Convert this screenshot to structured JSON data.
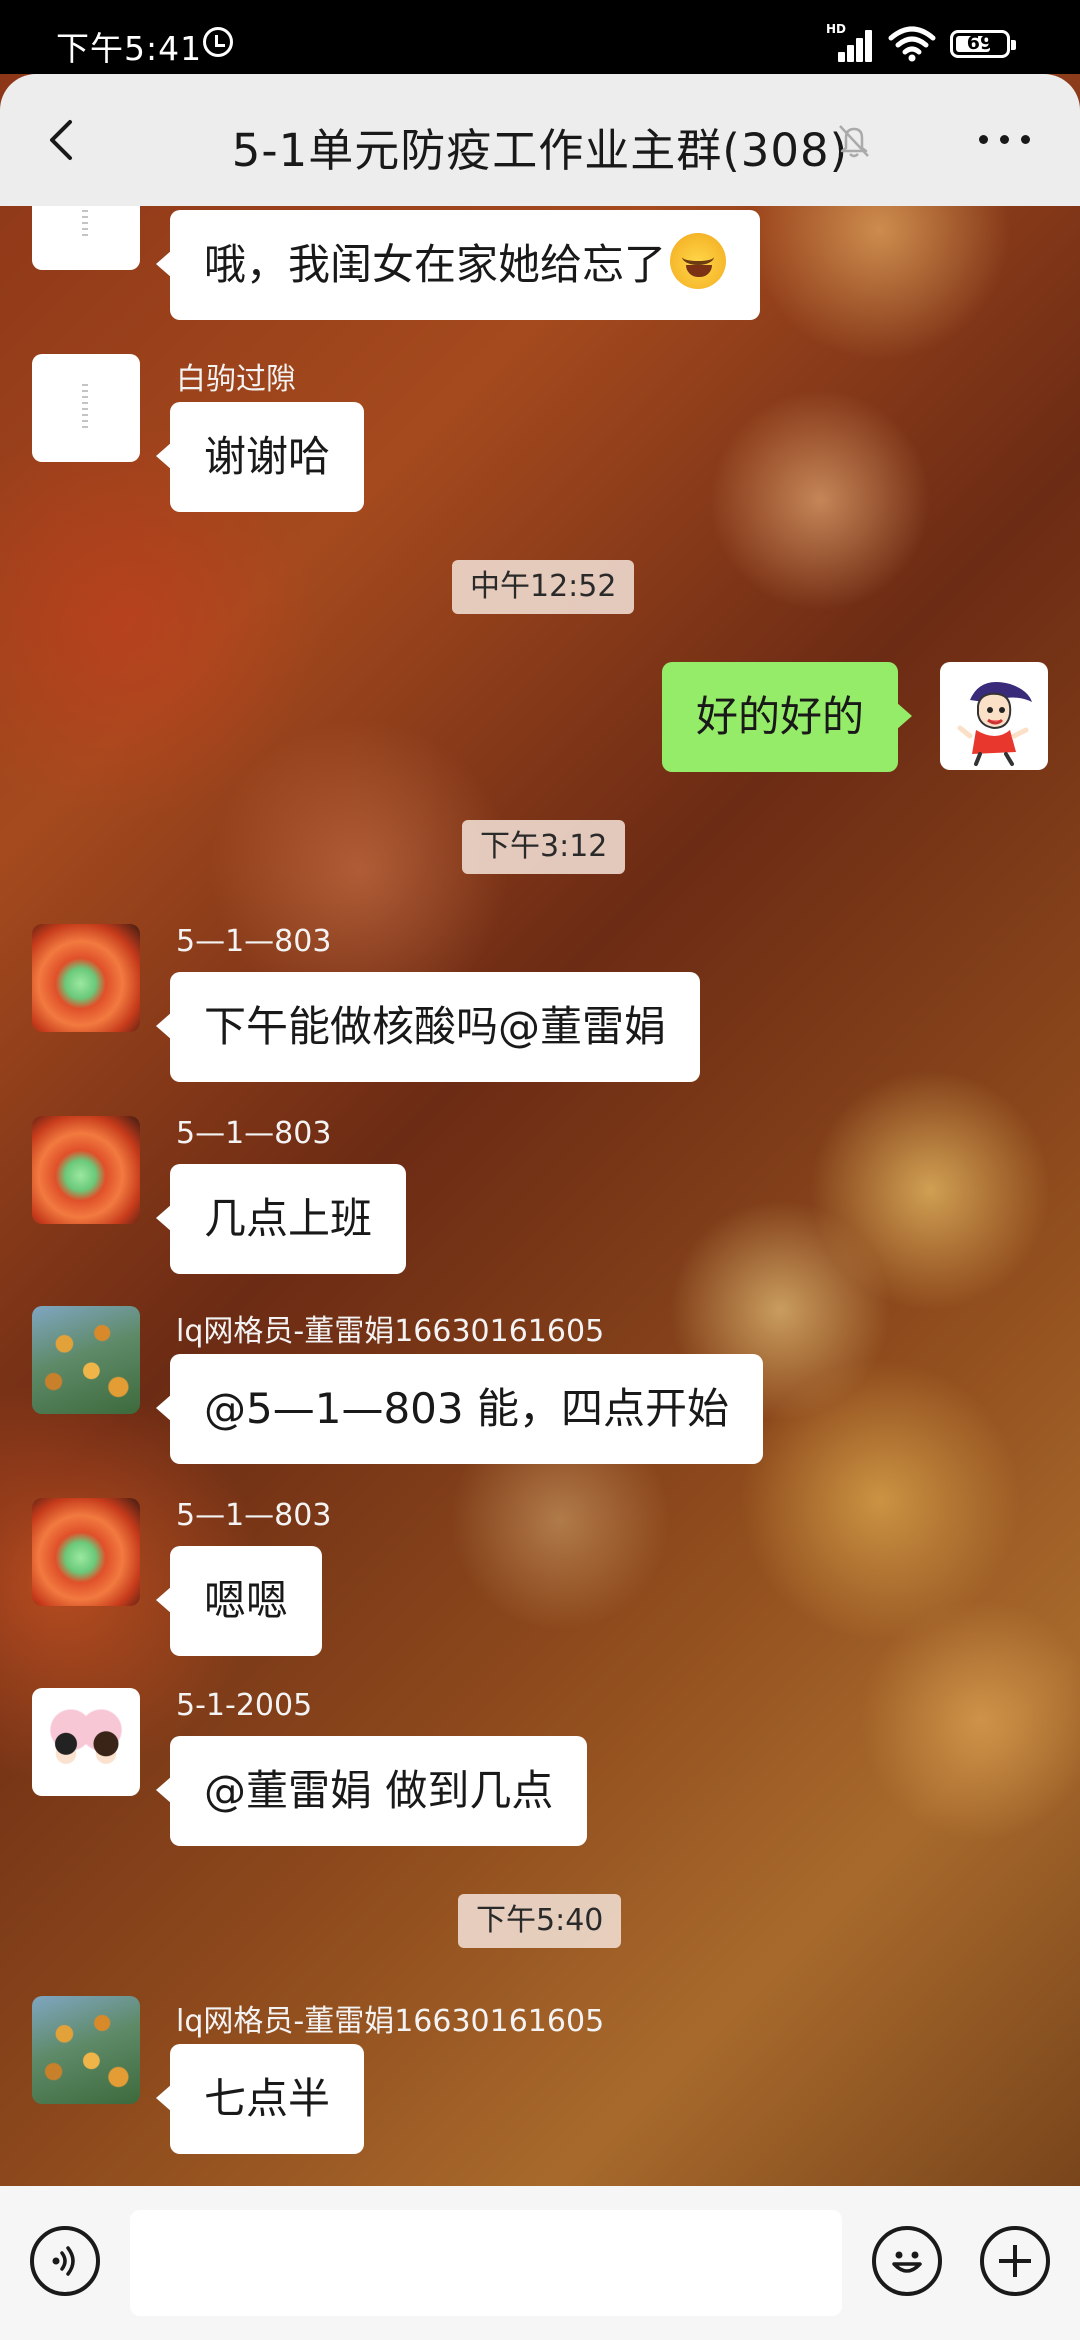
{
  "status_bar": {
    "time": "下午5:41",
    "network_label": "HD",
    "battery": "69"
  },
  "header": {
    "title": "5-1单元防疫工作业主群(308)"
  },
  "messages": [
    {
      "sender": "",
      "text": "哦，我闺女在家她给忘了",
      "has_emoji": true,
      "emoji_icon": "laughing-crying-emoji-icon"
    },
    {
      "sender": "白驹过隙",
      "text": "谢谢哈"
    },
    {
      "timestamp": "中午12:52"
    },
    {
      "sender": "me",
      "text": "好的好的"
    },
    {
      "timestamp": "下午3:12"
    },
    {
      "sender": "5—1—803",
      "text": "下午能做核酸吗@董雷娟"
    },
    {
      "sender": "5—1—803",
      "text": "几点上班"
    },
    {
      "sender": "lq网格员-董雷娟16630161605",
      "text": "@5—1—803  能，四点开始"
    },
    {
      "sender": "5—1—803",
      "text": "嗯嗯"
    },
    {
      "sender": "5-1-2005",
      "text": "@董雷娟  做到几点"
    },
    {
      "timestamp": "下午5:40"
    },
    {
      "sender": "lq网格员-董雷娟16630161605",
      "text": "七点半"
    }
  ],
  "input_bar": {
    "placeholder": "",
    "voice_icon": "voice-icon",
    "emoji_icon": "emoji-icon",
    "plus_icon": "plus-icon"
  },
  "colors": {
    "outgoing_bubble": "#95ec69",
    "incoming_bubble": "#ffffff",
    "header_bg": "#ededed",
    "input_bar_bg": "#f6f6f6"
  }
}
